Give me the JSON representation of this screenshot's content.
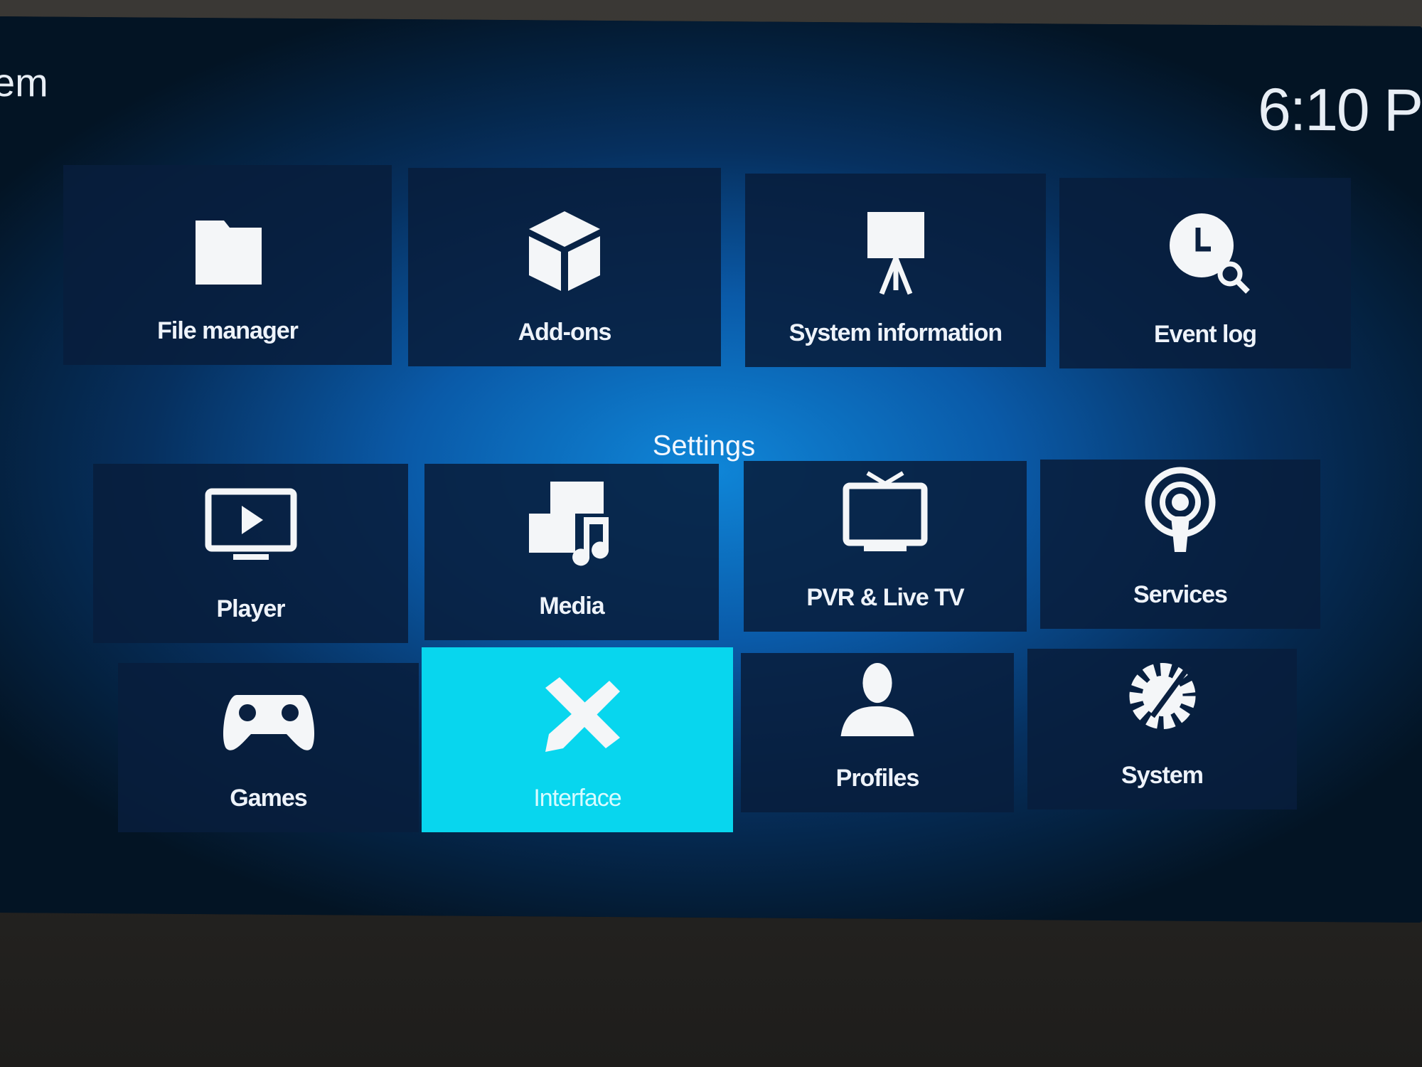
{
  "header": {
    "title_fragment": "em",
    "clock_fragment": "6:10 P"
  },
  "section_label": "Settings",
  "selected_color": "#08d6ee",
  "tiles": [
    {
      "label": "File manager",
      "icon": "folder-icon"
    },
    {
      "label": "Add-ons",
      "icon": "box-icon"
    },
    {
      "label": "System information",
      "icon": "presentation-icon"
    },
    {
      "label": "Event log",
      "icon": "clock-search-icon"
    },
    {
      "label": "Player",
      "icon": "monitor-play-icon"
    },
    {
      "label": "Media",
      "icon": "media-icon"
    },
    {
      "label": "PVR & Live TV",
      "icon": "tv-icon"
    },
    {
      "label": "Services",
      "icon": "podcast-icon"
    },
    {
      "label": "Games",
      "icon": "gamepad-icon"
    },
    {
      "label": "Interface",
      "icon": "pencil-ruler-icon",
      "selected": true
    },
    {
      "label": "Profiles",
      "icon": "person-icon"
    },
    {
      "label": "System",
      "icon": "gear-icon"
    }
  ]
}
